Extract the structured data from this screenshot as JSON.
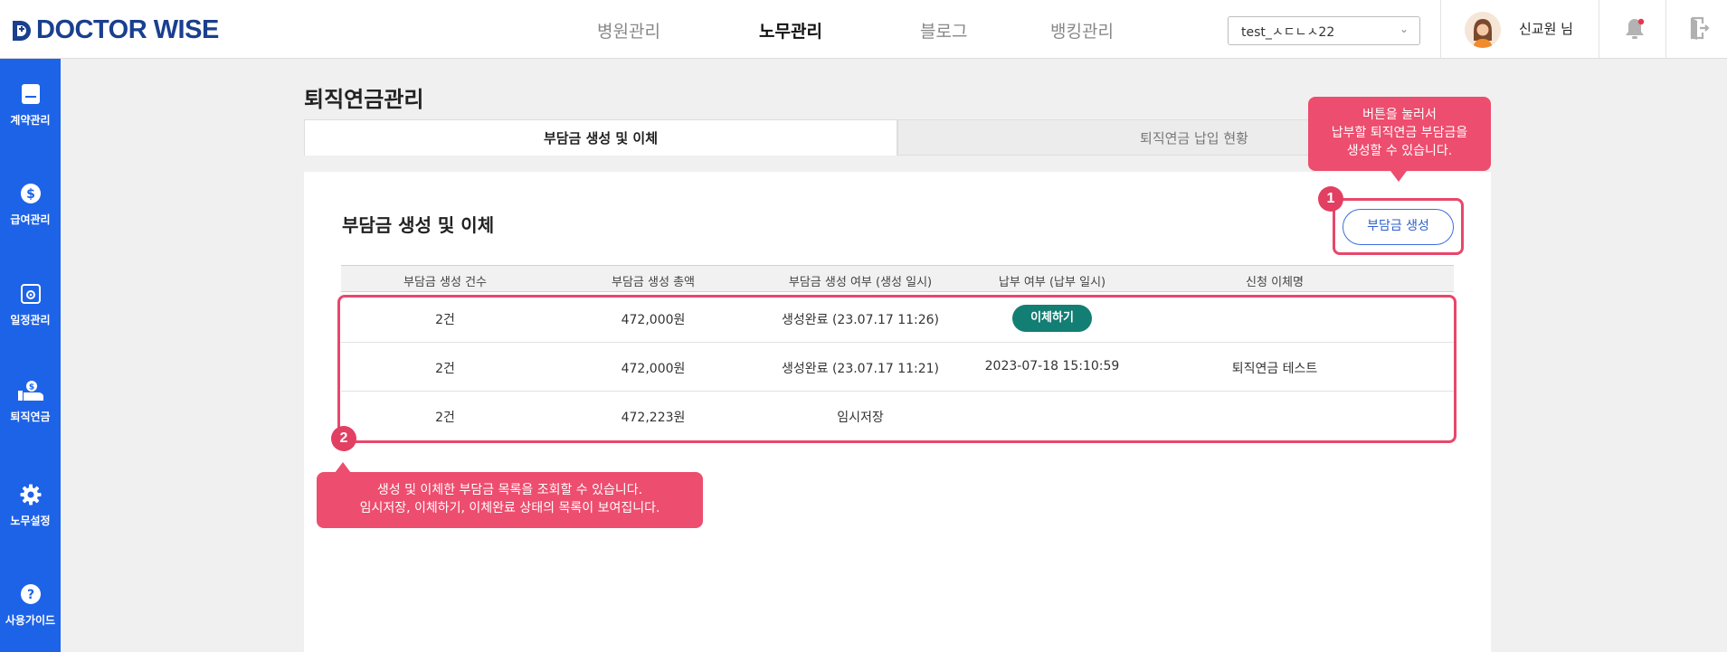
{
  "header": {
    "logo_text": "DOCTOR WISE",
    "nav": [
      {
        "label": "병원관리",
        "active": false
      },
      {
        "label": "노무관리",
        "active": true
      },
      {
        "label": "블로그",
        "active": false
      },
      {
        "label": "뱅킹관리",
        "active": false
      }
    ],
    "hospital_select": "test_ㅅㄷㄴㅅ22",
    "user_name": "신교원 님"
  },
  "sidebar": {
    "items": [
      {
        "label": "계약관리",
        "icon": "document-icon"
      },
      {
        "label": "급여관리",
        "icon": "dollar-icon"
      },
      {
        "label": "일정관리",
        "icon": "calendar-icon"
      },
      {
        "label": "퇴직연금",
        "icon": "money-hand-icon"
      },
      {
        "label": "노무설정",
        "icon": "gear-icon"
      },
      {
        "label": "사용가이드",
        "icon": "help-icon"
      }
    ]
  },
  "page": {
    "title": "퇴직연금관리",
    "tabs": [
      {
        "label": "부담금 생성 및 이체",
        "active": true
      },
      {
        "label": "퇴직연금 납입 현황",
        "active": false
      }
    ],
    "section_title": "부담금 생성 및 이체",
    "create_button": "부담금 생성"
  },
  "table": {
    "columns": [
      "부담금 생성 건수",
      "부담금 생성 총액",
      "부담금 생성 여부 (생성 일시)",
      "납부 여부 (납부 일시)",
      "신청 이체명"
    ],
    "rows": [
      {
        "count": "2건",
        "total": "472,000원",
        "status": "생성완료 (23.07.17 11:26)",
        "payment": "",
        "payment_button": "이체하기",
        "transfer_name": ""
      },
      {
        "count": "2건",
        "total": "472,000원",
        "status": "생성완료 (23.07.17 11:21)",
        "payment": "2023-07-18 15:10:59",
        "payment_button": "",
        "transfer_name": "퇴직연금 테스트"
      },
      {
        "count": "2건",
        "total": "472,223원",
        "status": "임시저장",
        "payment": "",
        "payment_button": "",
        "transfer_name": ""
      }
    ]
  },
  "guide": {
    "step1": {
      "number": "1",
      "lines": [
        "버튼을 눌러서",
        "납부할 퇴직연금 부담금을",
        "생성할 수 있습니다."
      ]
    },
    "step2": {
      "number": "2",
      "lines": [
        "생성 및 이체한 부담금 목록을 조회할 수 있습니다.",
        "임시저장, 이체하기, 이체완료 상태의 목록이 보여집니다."
      ]
    }
  },
  "colors": {
    "sidebar": "#1d63e8",
    "brand": "#1a3f8f",
    "transfer_button": "#137e73",
    "guide_accent": "#ed4d6e"
  }
}
